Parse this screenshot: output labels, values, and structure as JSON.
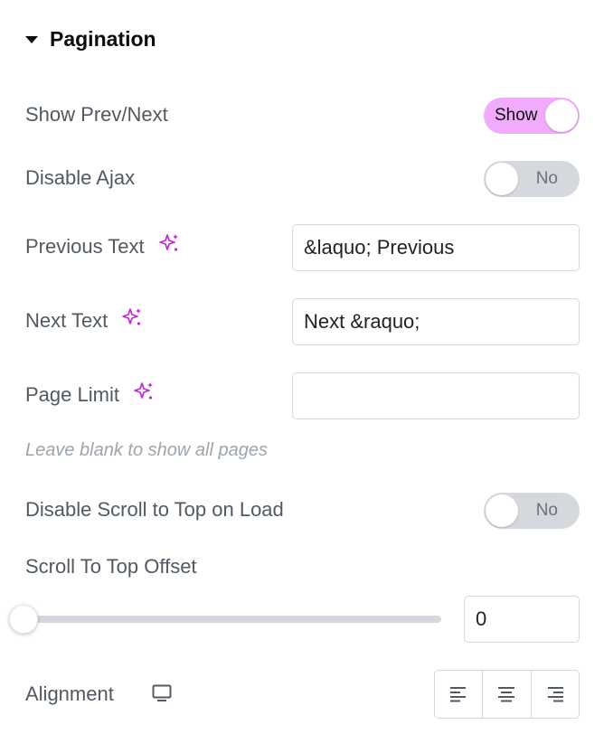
{
  "section": {
    "title": "Pagination",
    "expanded": true
  },
  "show_prev_next": {
    "label": "Show Prev/Next",
    "state_label": "Show",
    "on": true
  },
  "disable_ajax": {
    "label": "Disable Ajax",
    "state_label": "No",
    "on": false
  },
  "previous_text": {
    "label": "Previous Text",
    "value": "&laquo; Previous"
  },
  "next_text": {
    "label": "Next Text",
    "value": "Next &raquo;"
  },
  "page_limit": {
    "label": "Page Limit",
    "value": "",
    "hint": "Leave blank to show all pages"
  },
  "disable_scroll_top": {
    "label": "Disable Scroll to Top on Load",
    "state_label": "No",
    "on": false
  },
  "scroll_offset": {
    "label": "Scroll To Top Offset",
    "value": "0",
    "slider_fraction": 0
  },
  "alignment": {
    "label": "Alignment",
    "device_icon": "desktop-icon",
    "options": [
      "align-left-icon",
      "align-center-icon",
      "align-right-icon"
    ]
  },
  "colors": {
    "accent": "#f0abfc",
    "ai_icon": "#c026d3",
    "toggle_off": "#d5d8dc",
    "label": "#515962"
  }
}
